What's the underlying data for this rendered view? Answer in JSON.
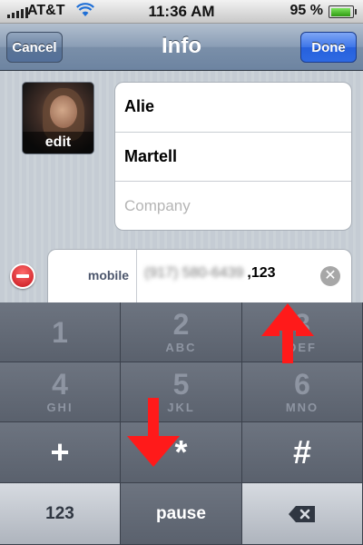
{
  "status_bar": {
    "carrier": "AT&T",
    "time": "11:36 AM",
    "battery_pct": "95 %"
  },
  "nav": {
    "title": "Info",
    "cancel_label": "Cancel",
    "done_label": "Done"
  },
  "contact": {
    "photo_edit_label": "edit",
    "first_name": "Alie",
    "last_name": "Martell",
    "company_placeholder": "Company",
    "phone": {
      "label": "mobile",
      "number_blurred": "(917) 580-6439",
      "suffix": ",123"
    }
  },
  "keypad": {
    "keys": [
      {
        "digit": "1",
        "letters": ""
      },
      {
        "digit": "2",
        "letters": "ABC"
      },
      {
        "digit": "3",
        "letters": "DEF"
      },
      {
        "digit": "4",
        "letters": "GHI"
      },
      {
        "digit": "5",
        "letters": "JKL"
      },
      {
        "digit": "6",
        "letters": "MNO"
      }
    ],
    "plus": "+",
    "star": "*",
    "hash": "#",
    "num_switch": "123",
    "pause": "pause"
  },
  "colors": {
    "accent_blue": "#2e6ae3",
    "annotation_red": "#ff1a1a",
    "delete_red": "#c4121a"
  }
}
